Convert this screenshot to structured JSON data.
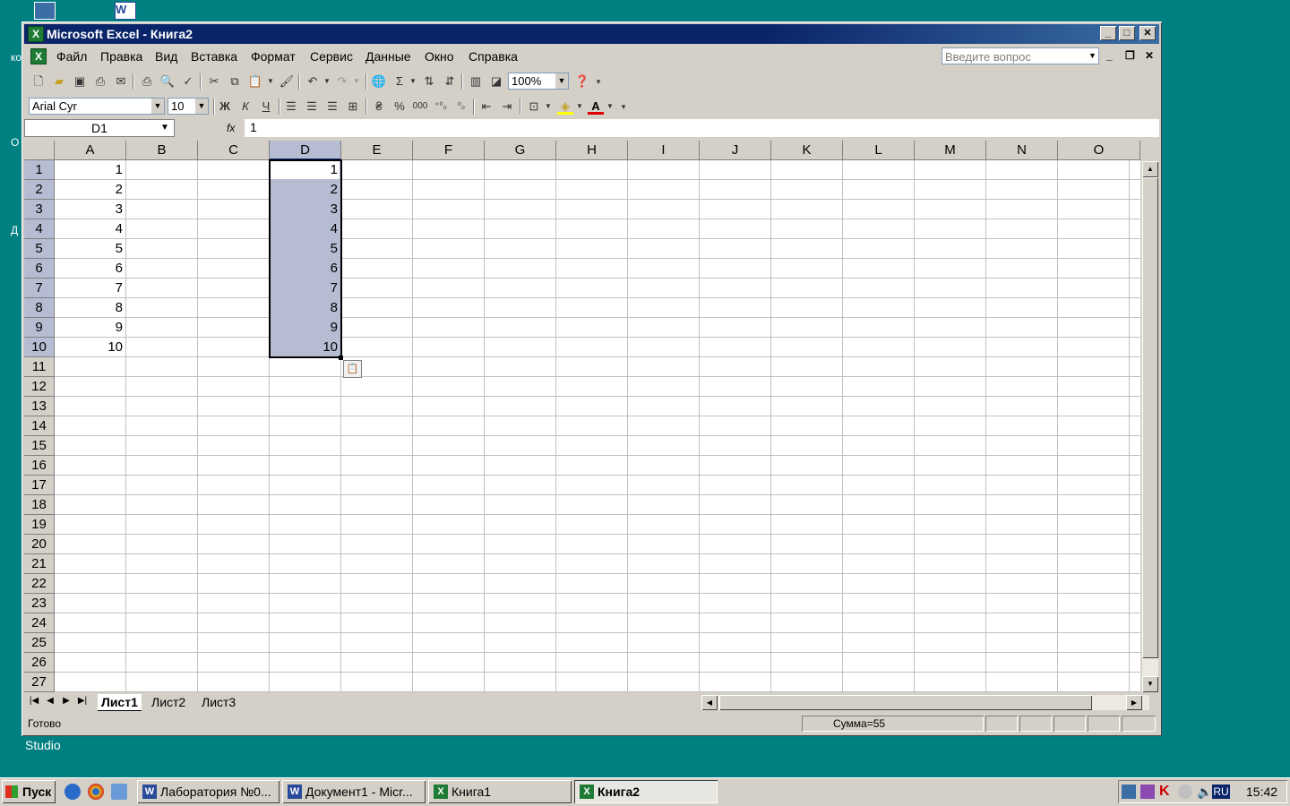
{
  "desktop": {
    "icon_label_studio": "Studio",
    "edge_letters": [
      "ко",
      "О",
      "Д"
    ]
  },
  "window": {
    "title": "Microsoft Excel - Книга2",
    "minimize_glyph": "_",
    "maximize_glyph": "□",
    "close_glyph": "✕"
  },
  "menu": {
    "items": [
      "Файл",
      "Правка",
      "Вид",
      "Вставка",
      "Формат",
      "Сервис",
      "Данные",
      "Окно",
      "Справка"
    ],
    "ask_placeholder": "Введите вопрос"
  },
  "toolbar": {
    "zoom": "100%",
    "font_name": "Arial Cyr",
    "font_size": "10",
    "bold_label": "Ж",
    "italic_label": "К",
    "underline_label": "Ч",
    "sigma": "Σ",
    "percent": "%",
    "thousands": "000",
    "inc_dec": "⁺⁰₀",
    "dec_dec": "⁰₀"
  },
  "formula_bar": {
    "name_box": "D1",
    "fx": "fx",
    "content": "1"
  },
  "grid": {
    "columns": [
      "A",
      "B",
      "C",
      "D",
      "E",
      "F",
      "G",
      "H",
      "I",
      "J",
      "K",
      "L",
      "M",
      "N",
      "O"
    ],
    "selected_column": "D",
    "rows": [
      "1",
      "2",
      "3",
      "4",
      "5",
      "6",
      "7",
      "8",
      "9",
      "10",
      "11",
      "12",
      "13",
      "14",
      "15",
      "16",
      "17",
      "18",
      "19",
      "20",
      "21",
      "22",
      "23",
      "24",
      "25",
      "26",
      "27"
    ],
    "col_a": [
      "1",
      "2",
      "3",
      "4",
      "5",
      "6",
      "7",
      "8",
      "9",
      "10"
    ],
    "col_d": [
      "1",
      "2",
      "3",
      "4",
      "5",
      "6",
      "7",
      "8",
      "9",
      "10"
    ]
  },
  "sheets": {
    "tabs": [
      "Лист1",
      "Лист2",
      "Лист3"
    ],
    "active": "Лист1"
  },
  "status": {
    "ready": "Готово",
    "sum": "Сумма=55"
  },
  "taskbar": {
    "start": "Пуск",
    "tasks": [
      "Лаборатория №0...",
      "Документ1 - Micr...",
      "Книга1",
      "Книга2"
    ],
    "lang": "RU",
    "clock": "15:42"
  },
  "colors": {
    "title_bar": "#0a246a",
    "desktop": "#008080",
    "selection": "#b6bdd2",
    "excel_green": "#1e7a34"
  }
}
